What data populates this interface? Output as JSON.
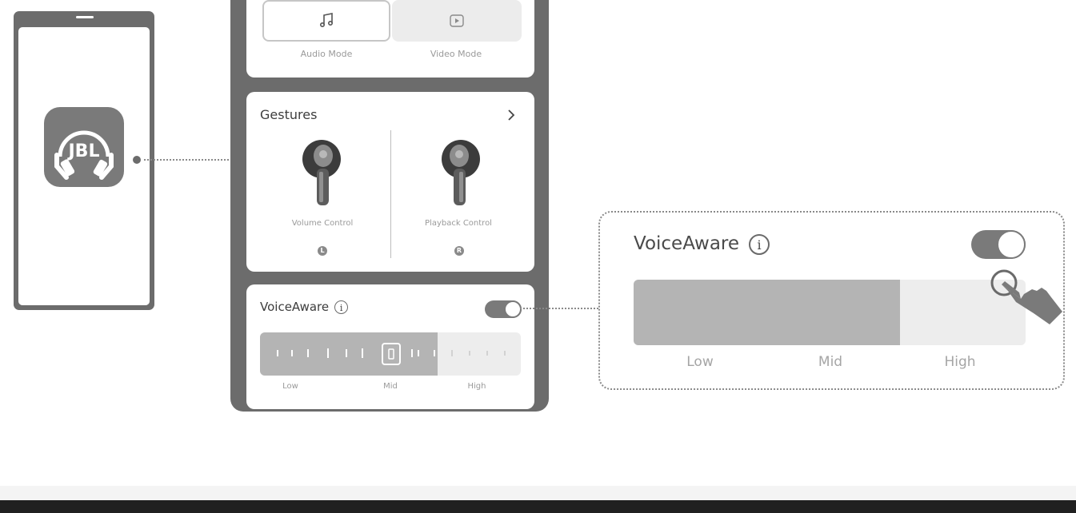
{
  "app_icon": {
    "brand": "JBL"
  },
  "sound_mode": {
    "audio_label": "Audio Mode",
    "video_label": "Video Mode",
    "selected": "Audio Mode"
  },
  "gestures": {
    "title": "Gestures",
    "left": {
      "label": "Volume Control",
      "side": "L"
    },
    "right": {
      "label": "Playback Control",
      "side": "R"
    }
  },
  "voiceaware": {
    "title": "VoiceAware",
    "info_glyph": "i",
    "enabled": true,
    "level_fraction": 0.68,
    "levels": [
      "Low",
      "Mid",
      "High"
    ]
  },
  "callout": {
    "title": "VoiceAware",
    "info_glyph": "i",
    "enabled": true,
    "level_fraction": 0.68,
    "levels": [
      "Low",
      "Mid",
      "High"
    ]
  },
  "colors": {
    "device_gray": "#6c6c6c",
    "fill_gray": "#b4b4b4",
    "track_gray": "#ededed"
  },
  "icons": [
    "music-note-icon",
    "video-play-icon",
    "chevron-right-icon",
    "info-icon",
    "toggle-switch",
    "hand-tap-icon",
    "earbud-icon",
    "jbl-headphones-logo"
  ]
}
